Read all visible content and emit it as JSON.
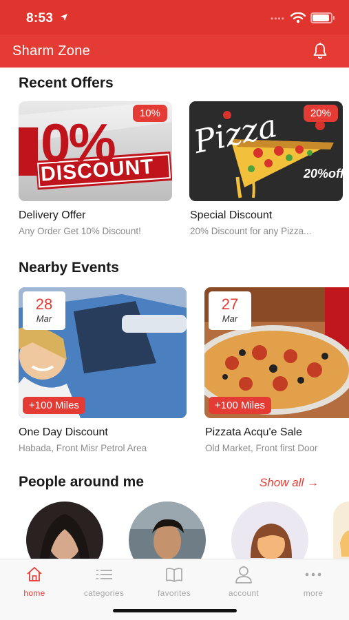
{
  "status": {
    "time": "8:53"
  },
  "app": {
    "title": "Sharm Zone"
  },
  "recent_offers": {
    "title": "Recent Offers",
    "items": [
      {
        "badge": "10%",
        "title": "Delivery Offer",
        "subtitle": "Any Order Get 10% Discount!",
        "image_text_big": "0%",
        "image_text_small": "DISCOUNT"
      },
      {
        "badge": "20%",
        "title": "Special Discount",
        "subtitle": "20% Discount for any Pizza...",
        "image_text_big": "Pizza",
        "image_text_small": "20%off"
      }
    ]
  },
  "nearby_events": {
    "title": "Nearby Events",
    "items": [
      {
        "day": "28",
        "month": "Mar",
        "distance": "+100 Miles",
        "title": "One Day Discount",
        "subtitle": "Habada, Front Misr Petrol Area"
      },
      {
        "day": "27",
        "month": "Mar",
        "distance": "+100 Miles",
        "title": "Pizzata Acqu'e Sale",
        "subtitle": "Old Market, Front first Door"
      }
    ]
  },
  "people": {
    "title": "People around me",
    "show_all": "Show all →"
  },
  "tabs": [
    {
      "label": "home",
      "icon": "home-icon"
    },
    {
      "label": "categories",
      "icon": "list-icon"
    },
    {
      "label": "favorites",
      "icon": "book-icon"
    },
    {
      "label": "account",
      "icon": "user-icon"
    },
    {
      "label": "more",
      "icon": "more-icon"
    }
  ],
  "colors": {
    "primary": "#e53b35",
    "status_bar": "#e0342e",
    "tab_inactive": "#a8a8a8"
  }
}
